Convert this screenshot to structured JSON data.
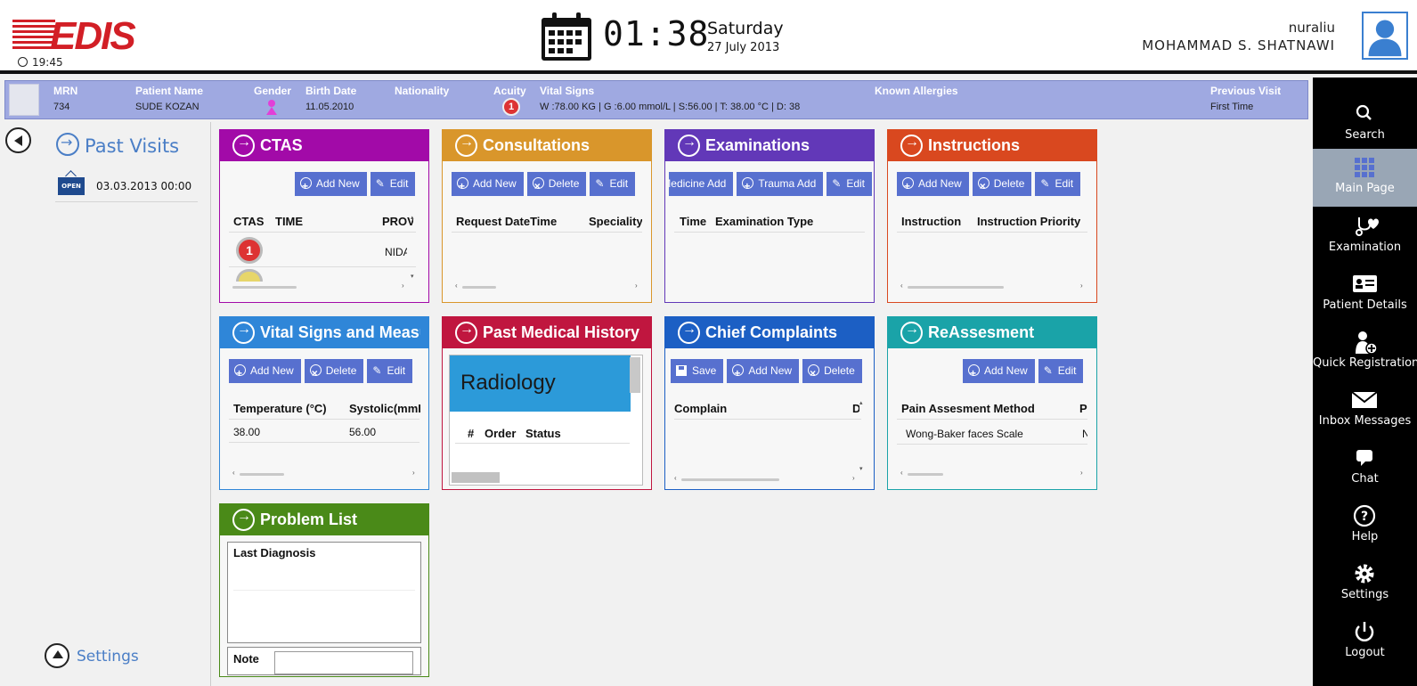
{
  "header": {
    "logo_text": "EDIS",
    "small_time": "19:45",
    "time": "01:38",
    "day": "Saturday",
    "date": "27 July 2013",
    "username": "nuraliu",
    "fullname": "MOHAMMAD S.  SHATNAWI"
  },
  "patient": {
    "mrn_label": "MRN",
    "mrn": "734",
    "name_label": "Patient Name",
    "name": "SUDE KOZAN",
    "gender_label": "Gender",
    "birth_label": "Birth Date",
    "birth": "11.05.2010",
    "nationality_label": "Nationality",
    "nationality": "",
    "acuity_label": "Acuity",
    "acuity": "1",
    "vitals_label": "Vital Signs",
    "vitals": "W :78.00 KG | G :6.00 mmol/L  |  S:56.00  |  T: 38.00 °C  |  D: 38",
    "allergies_label": "Known Allergies",
    "allergies": "",
    "prev_visit_label": "Previous Visit",
    "prev_visit": "First Time",
    "gender_color": "#e23fd8"
  },
  "left": {
    "past_visits_title": "Past Visits",
    "visit_badge": "OPEN",
    "visit_date": "03.03.2013 00:00",
    "settings_label": "Settings"
  },
  "sidebar": {
    "items": [
      {
        "label": "Search",
        "icon": "search-icon"
      },
      {
        "label": "Main Page",
        "icon": "grid-icon"
      },
      {
        "label": "Examination",
        "icon": "stethoscope-icon"
      },
      {
        "label": "Patient Details",
        "icon": "id-card-icon"
      },
      {
        "label": "Quick Registration",
        "icon": "add-user-icon"
      },
      {
        "label": "Inbox Messages",
        "icon": "envelope-icon"
      },
      {
        "label": "Chat",
        "icon": "chat-icon"
      },
      {
        "label": "Help",
        "icon": "help-icon"
      },
      {
        "label": "Settings",
        "icon": "gear-icon"
      },
      {
        "label": "Logout",
        "icon": "power-icon"
      }
    ],
    "active": "Main Page"
  },
  "panels": {
    "ctas": {
      "title": "CTAS",
      "color": "#a20aa8",
      "buttons": [
        "Add New",
        "Edit"
      ],
      "columns": [
        "CTAS",
        "TIME",
        "PROV"
      ],
      "row_provider": "NIDA",
      "row_ctas": "1"
    },
    "consultations": {
      "title": "Consultations",
      "color": "#d9962b",
      "buttons": [
        "Add New",
        "Delete",
        "Edit"
      ],
      "columns": [
        "Request DateTime",
        "Speciality"
      ]
    },
    "examinations": {
      "title": "Examinations",
      "color": "#6238b8",
      "buttons": [
        "Medicine Add",
        "Trauma Add",
        "Edit"
      ],
      "columns": [
        "Time",
        "Examination Type"
      ]
    },
    "instructions": {
      "title": "Instructions",
      "color": "#d9481f",
      "buttons": [
        "Add New",
        "Delete",
        "Edit"
      ],
      "columns": [
        "Instruction",
        "Instruction Priority"
      ]
    },
    "vitals": {
      "title": "Vital Signs and Measurements",
      "color": "#2f86d8",
      "buttons": [
        "Add New",
        "Delete",
        "Edit"
      ],
      "columns": [
        "Temperature (°C)",
        "Systolic(mmHg)"
      ],
      "row": [
        "38.00",
        "56.00"
      ]
    },
    "pmh": {
      "title": "Past Medical History",
      "color": "#c0163f",
      "radiology": "Radiology",
      "columns": [
        "#",
        "Order",
        "Status"
      ]
    },
    "complaints": {
      "title": "Chief Complaints",
      "color": "#1c5fc4",
      "buttons": [
        "Save",
        "Add New",
        "Delete"
      ],
      "columns": [
        "Complain",
        "D"
      ]
    },
    "reassessment": {
      "title": "ReAssesment",
      "color": "#1aa3a8",
      "buttons": [
        "Add New",
        "Edit"
      ],
      "columns": [
        "Pain Assesment Method",
        "P"
      ],
      "row": [
        "Wong-Baker faces Scale",
        "N"
      ]
    },
    "problems": {
      "title": "Problem List",
      "color": "#4a8a18",
      "last_diagnosis": "Last Diagnosis",
      "note_label": "Note"
    }
  }
}
